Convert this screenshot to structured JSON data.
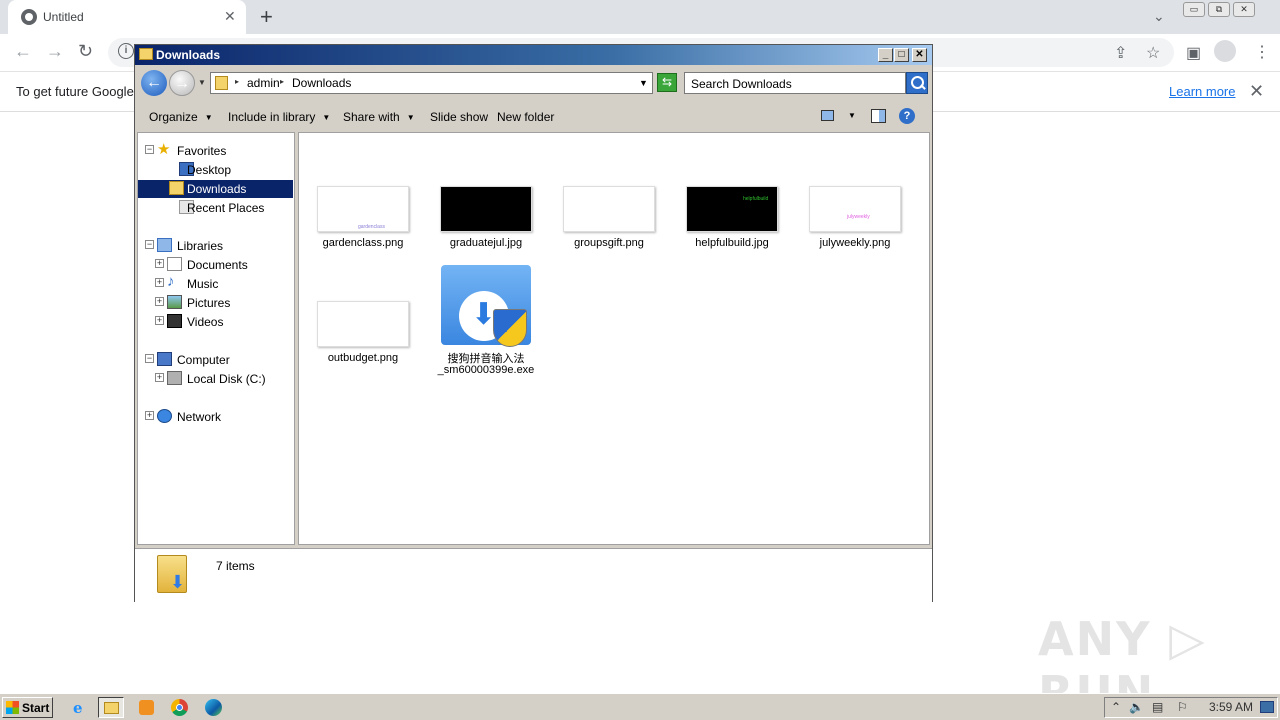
{
  "browser": {
    "tab_title": "Untitled",
    "tab_close": "✕",
    "new_tab": "+",
    "tab_search": "⌄",
    "window_buttons": [
      "▭",
      "⧉",
      "✕"
    ],
    "nav": {
      "back": "←",
      "forward": "→",
      "reload": "↻"
    },
    "info_icon": "i",
    "toolbar_icons": {
      "share": "⇪",
      "bookmark": "☆",
      "sidepanel": "▣",
      "menu": "⋮"
    },
    "infobar": {
      "message": "To get future Google",
      "learn_more": "Learn more",
      "close": "✕"
    }
  },
  "explorer": {
    "title": "Downloads",
    "title_buttons": [
      "_",
      "□",
      "✕"
    ],
    "back": "←",
    "forward": "→",
    "address": {
      "segments": [
        "admin",
        "Downloads"
      ],
      "separator": "▸"
    },
    "refresh": "⇆",
    "search_placeholder": "Search Downloads",
    "commands": [
      {
        "label": "Organize",
        "dropdown": true
      },
      {
        "label": "Include in library",
        "dropdown": true
      },
      {
        "label": "Share with",
        "dropdown": true
      },
      {
        "label": "Slide show",
        "dropdown": false
      },
      {
        "label": "New folder",
        "dropdown": false
      }
    ],
    "help": "?",
    "nav_tree": {
      "favorites": "Favorites",
      "desktop": "Desktop",
      "downloads": "Downloads",
      "recent_places": "Recent Places",
      "libraries": "Libraries",
      "documents": "Documents",
      "music": "Music",
      "pictures": "Pictures",
      "videos": "Videos",
      "computer": "Computer",
      "local_disk": "Local Disk (C:)",
      "network": "Network",
      "expand_minus": "−",
      "expand_plus": "+"
    },
    "files": [
      {
        "name": "gardenclass.png",
        "bg": "#ffffff",
        "thumb_text": "gardenclass",
        "thumb_color": "#8a7fd6"
      },
      {
        "name": "graduatejul.jpg",
        "bg": "#000000",
        "thumb_text": "",
        "thumb_color": "#1a1a5a"
      },
      {
        "name": "groupsgift.png",
        "bg": "#ffffff",
        "thumb_text": "",
        "thumb_color": "#aaa"
      },
      {
        "name": "helpfulbuild.jpg",
        "bg": "#000000",
        "thumb_text": "helpfulbuild",
        "thumb_color": "#2fbf2f"
      },
      {
        "name": "julyweekly.png",
        "bg": "#ffffff",
        "thumb_text": "julyweekly",
        "thumb_color": "#e060e0"
      },
      {
        "name": "outbudget.png",
        "bg": "#ffffff",
        "thumb_text": "",
        "thumb_color": "#aaa"
      }
    ],
    "exe_file": {
      "name_line1": "搜狗拼音输入法",
      "name_line2": "_sm60000399e.exe"
    },
    "status": "7 items"
  },
  "watermark": "ANY ▷ RUN",
  "taskbar": {
    "start": "Start",
    "clock": "3:59 AM"
  }
}
